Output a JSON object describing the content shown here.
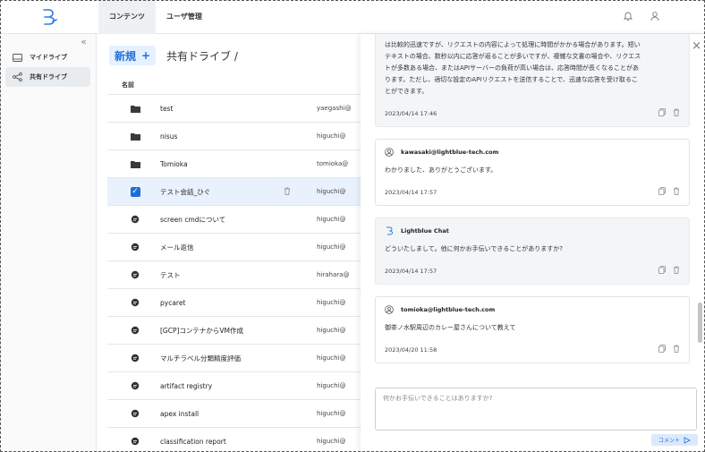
{
  "header": {
    "tabs": [
      {
        "label": "コンテンツ"
      },
      {
        "label": "ユーザ管理"
      }
    ]
  },
  "sidebar": {
    "items": [
      {
        "label": "マイドライブ"
      },
      {
        "label": "共有ドライブ"
      }
    ]
  },
  "main": {
    "new_label": "新規",
    "new_plus": "+",
    "breadcrumb": "共有ドライブ /",
    "column_name": "名前",
    "files": [
      {
        "type": "folder",
        "name": "test",
        "owner": "yaegashi@"
      },
      {
        "type": "folder",
        "name": "nisus",
        "owner": "higuchi@"
      },
      {
        "type": "folder",
        "name": "Tomioka",
        "owner": "tomioka@"
      },
      {
        "type": "chat",
        "name": "テスト会話_ひぐ",
        "owner": "higuchi@",
        "selected": true
      },
      {
        "type": "chat",
        "name": "screen cmdについて",
        "owner": "higuchi@"
      },
      {
        "type": "chat",
        "name": "メール返信",
        "owner": "higuchi@"
      },
      {
        "type": "chat",
        "name": "テスト",
        "owner": "hirahara@"
      },
      {
        "type": "chat",
        "name": "pycaret",
        "owner": "higuchi@"
      },
      {
        "type": "chat",
        "name": "[GCP]コンテナからVM作成",
        "owner": "higuchi@"
      },
      {
        "type": "chat",
        "name": "マルチラベル分類精度評価",
        "owner": "higuchi@"
      },
      {
        "type": "chat",
        "name": "artifact registry",
        "owner": "higuchi@"
      },
      {
        "type": "chat",
        "name": "apex install",
        "owner": "higuchi@"
      },
      {
        "type": "chat",
        "name": "classification report",
        "owner": "higuchi@"
      }
    ]
  },
  "chat": {
    "messages": [
      {
        "role": "bot",
        "sender": "",
        "lines": [
          "は比較的迅速ですが、リクエストの内容によって処理に時間がかかる場合があります。短い",
          "テキストの場合、数秒以内に応答が返ることが多いですが、複雑な文書の場合や、リクエス",
          "トが多数ある場合、またはAPIサーバーの負荷が高い場合は、応答時間が長くなることがあ",
          "ります。ただし、適切な設定のAPIリクエストを送信することで、迅速な応答を受け取るこ",
          "とができます。"
        ],
        "time": "2023/04/14 17:46"
      },
      {
        "role": "user",
        "sender": "kawasaki@lightblue-tech.com",
        "lines": [
          "わかりました、ありがとうございます。"
        ],
        "time": "2023/04/14 17:57"
      },
      {
        "role": "bot",
        "sender": "Lightblue Chat",
        "lines": [
          "どういたしまして。他に何かお手伝いできることがありますか?"
        ],
        "time": "2023/04/14 17:57"
      },
      {
        "role": "user",
        "sender": "tomioka@lightblue-tech.com",
        "lines": [
          "御茶ノ水駅周辺のカレー屋さんについて教えて"
        ],
        "time": "2023/04/20 11:58"
      }
    ],
    "composer_placeholder": "何かお手伝いできることはありますか?",
    "send_label": "コメント"
  }
}
